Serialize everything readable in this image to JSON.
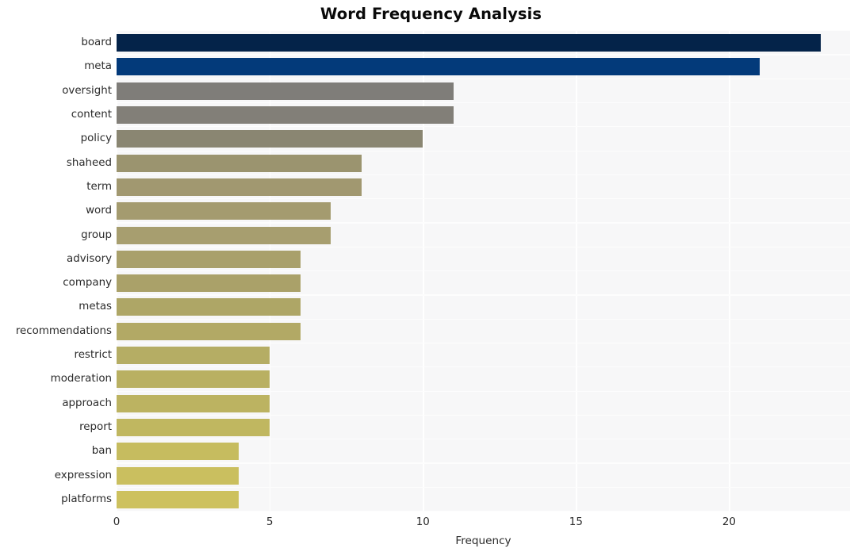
{
  "chart_data": {
    "type": "bar",
    "orientation": "horizontal",
    "title": "Word Frequency Analysis",
    "xlabel": "Frequency",
    "ylabel": "",
    "xlim": [
      0,
      23.95
    ],
    "xticks": [
      0,
      5,
      10,
      15,
      20
    ],
    "xtick_labels": [
      "0",
      "5",
      "10",
      "15",
      "20"
    ],
    "grid": true,
    "legend": false,
    "categories": [
      "board",
      "meta",
      "oversight",
      "content",
      "policy",
      "shaheed",
      "term",
      "word",
      "group",
      "advisory",
      "company",
      "metas",
      "recommendations",
      "restrict",
      "moderation",
      "approach",
      "report",
      "ban",
      "expression",
      "platforms"
    ],
    "values": [
      23,
      21,
      11,
      11,
      10,
      8,
      8,
      7,
      7,
      6,
      6,
      6,
      6,
      5,
      5,
      5,
      5,
      4,
      4,
      4
    ],
    "bar_colors": [
      "#042349",
      "#033a7a",
      "#7f7d79",
      "#827f78",
      "#8a8672",
      "#9b946f",
      "#a19870",
      "#a49b6f",
      "#a79e6f",
      "#a9a06b",
      "#aaa169",
      "#aea666",
      "#b2a965",
      "#b5ad64",
      "#b9b062",
      "#bcb361",
      "#c0b760",
      "#c6bc5f",
      "#cabf5f",
      "#cdc15e"
    ],
    "plot_background": "#f7f7f8",
    "gridline_color": "#ffffff",
    "figure_background": "#ffffff"
  }
}
